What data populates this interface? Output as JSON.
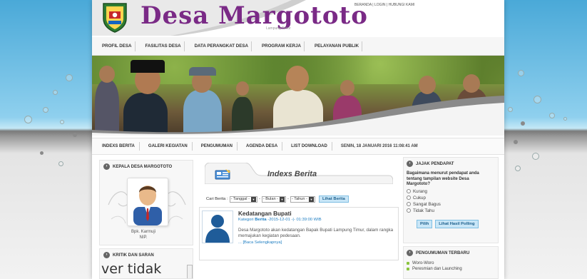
{
  "header": {
    "title": "Desa Margototo",
    "subtitle": "Lampung Timur",
    "top_links": "BERANDA | LOGIN | HUBUNGI KAMI"
  },
  "nav_main": [
    "PROFIL DESA",
    "FASILITAS DESA",
    "DATA PERANGKAT DESA",
    "PROGRAM KERJA",
    "PELAYANAN PUBLIK"
  ],
  "nav_secondary": {
    "items": [
      "INDEXS BERITA",
      "GALERI KEGIATAN",
      "PENGUMUMAN",
      "AGENDA DESA",
      "LIST DOWNLOAD"
    ],
    "datetime": "SENIN, 18 JANUARI 2016 11:08:41 AM"
  },
  "kepala": {
    "heading": "KEPALA DESA MARGOTOTO",
    "name": "Bpk. Karmuji",
    "nip": "NIP."
  },
  "kritik": {
    "heading": "KRITIK DAN SARAN",
    "text": "ver tidak"
  },
  "berita": {
    "tab_title": "Indexs Berita",
    "search_label": "Cari Berita :",
    "tanggal": "- Tanggal -",
    "bulan": "- Bulan -",
    "tahun": "- Tahun -",
    "search_button": "Lihat Berita",
    "item": {
      "title": "Kedatangan Bupati",
      "kategori_label": "Kategori",
      "kategori": "Berita",
      "date": "-2015-12-01 -|- 01:39:00 WIB",
      "body": "Desa Margototo akan kedatangan Bapak Bupati Lampung Timur, dalam rangka memajukan kegiatan pedesaan.",
      "more": "... [Baca Selengkapnya]"
    }
  },
  "poll": {
    "heading": "JAJAK PENDAPAT",
    "question": "Bagaimana menurut pendapat anda tentang tampilan website Desa Margototo?",
    "options": [
      "Kurang",
      "Cukup",
      "Sangat Bagus",
      "Tidak Tahu"
    ],
    "vote_button": "Pilih",
    "result_button": "Lihat Hasil Polling"
  },
  "pengumuman": {
    "heading": "PENGUMUMAN TERBARU",
    "items": [
      "Woro-Woro",
      "Peresmian dan Launching"
    ]
  },
  "colors": {
    "title_purple": "#7a2a86",
    "link_blue": "#1f7ec2",
    "bullet_green": "#8bc53f"
  }
}
